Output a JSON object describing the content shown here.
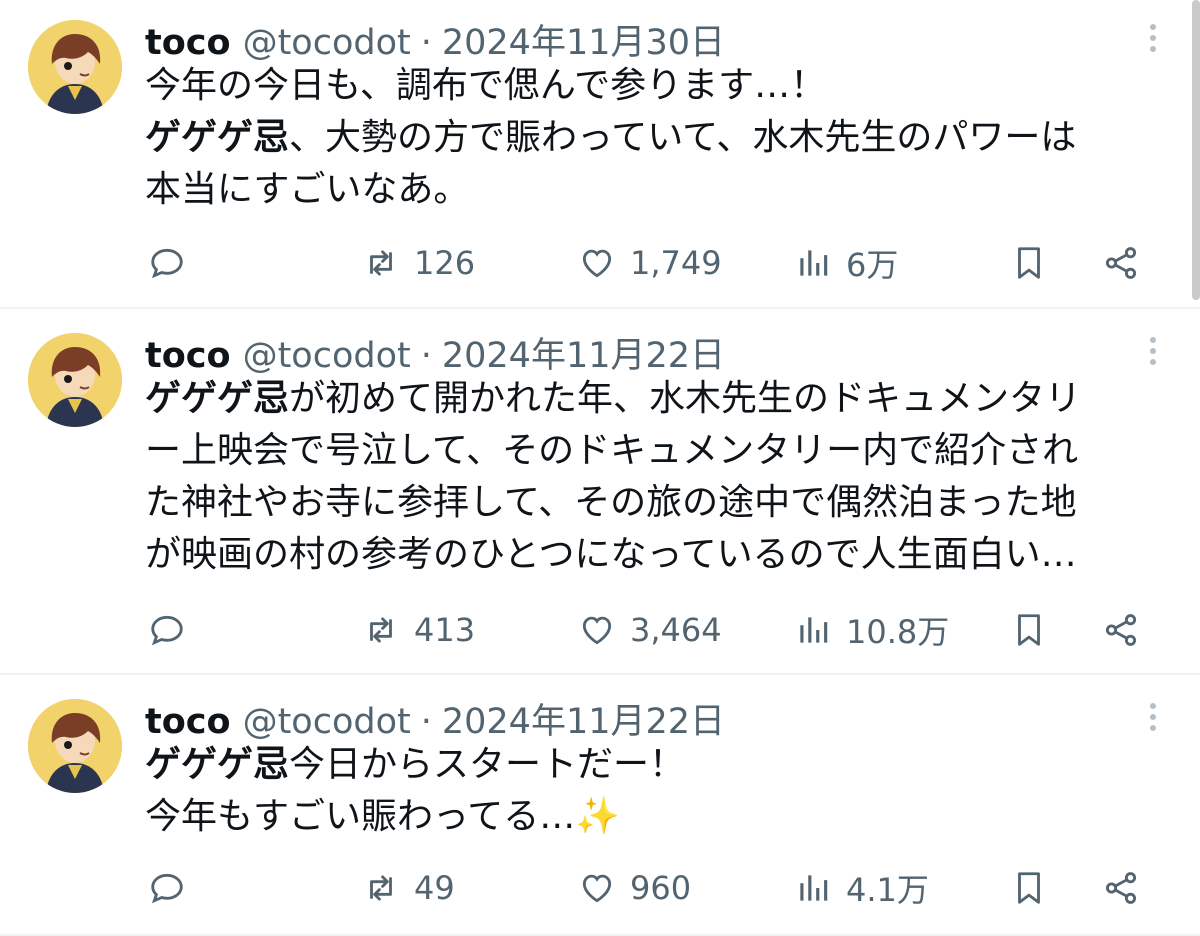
{
  "tweets": [
    {
      "name": "toco",
      "handle": "@tocodot",
      "sep": "·",
      "date": "2024年11月30日",
      "lines": [
        "今年の今日も、調布で偲んで参ります…！",
        "",
        "本当にすごいなあ。"
      ],
      "line2_bold": "ゲゲゲ忌",
      "line2_rest": "、大勢の方で賑わっていて、水木先生のパワーは",
      "retweets": "126",
      "likes": "1,749",
      "views": "6万"
    },
    {
      "name": "toco",
      "handle": "@tocodot",
      "sep": "·",
      "date": "2024年11月22日",
      "line1_bold": "ゲゲゲ忌",
      "line1_rest": "が初めて開かれた年、水木先生のドキュメンタリ",
      "lines": [
        "",
        "ー上映会で号泣して、そのドキュメンタリー内で紹介され",
        "た神社やお寺に参拝して、その旅の途中で偶然泊まった地",
        "が映画の村の参考のひとつになっているので人生面白い…"
      ],
      "retweets": "413",
      "likes": "3,464",
      "views": "10.8万"
    },
    {
      "name": "toco",
      "handle": "@tocodot",
      "sep": "·",
      "date": "2024年11月22日",
      "line1_bold": "ゲゲゲ忌",
      "line1_rest": "今日からスタートだー！",
      "line2": "今年もすごい賑わってる…",
      "emoji": "✨",
      "retweets": "49",
      "likes": "960",
      "views": "4.1万"
    }
  ],
  "icons": {
    "reply": "reply-icon",
    "retweet": "retweet-icon",
    "like": "heart-icon",
    "views": "views-icon",
    "bookmark": "bookmark-icon",
    "share": "share-icon",
    "more": "more-icon"
  },
  "colors": {
    "text": "#0f1419",
    "secondary": "#536471",
    "divider": "#eff3f4",
    "sparkle": "#f4a623"
  }
}
